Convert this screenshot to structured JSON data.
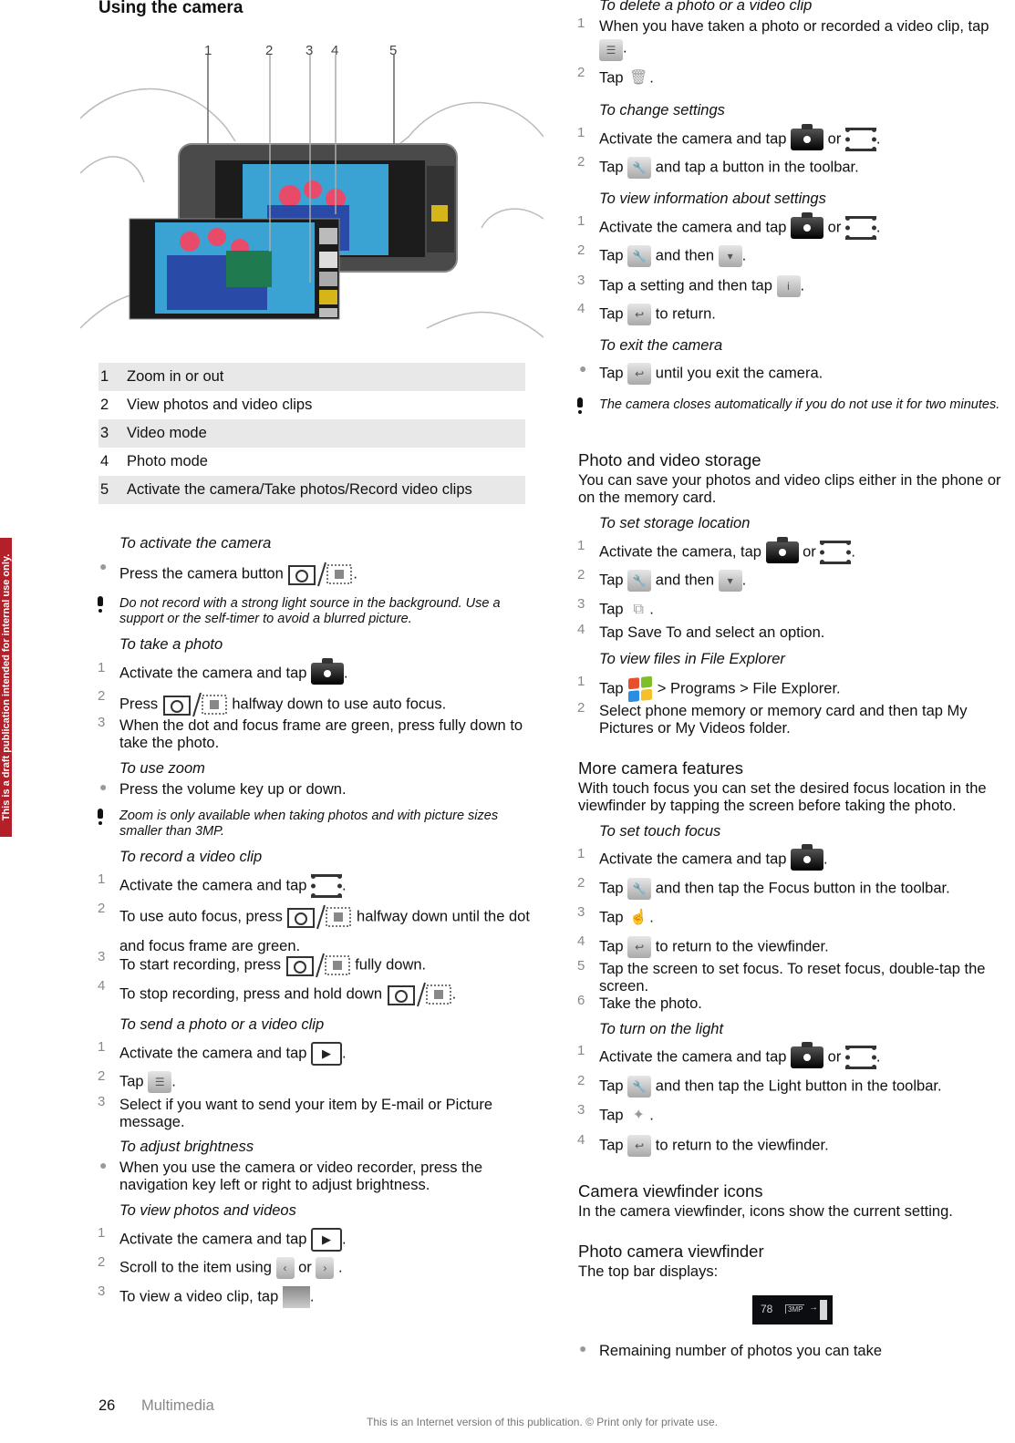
{
  "banner": {
    "text": "This is a draft publication intended for internal use only."
  },
  "left": {
    "title": "Using the camera",
    "figure": {
      "callouts": [
        "1",
        "2",
        "3",
        "4",
        "5"
      ],
      "description": "Two hands holding phone in landscape with camera viewfinder showing flowers"
    },
    "legend": [
      {
        "num": "1",
        "label": "Zoom in or out"
      },
      {
        "num": "2",
        "label": "View photos and video clips"
      },
      {
        "num": "3",
        "label": "Video mode"
      },
      {
        "num": "4",
        "label": "Photo mode"
      },
      {
        "num": "5",
        "label": "Activate the camera/Take photos/Record video clips"
      }
    ],
    "activate": {
      "title": "To activate the camera",
      "bullet": "Press the camera button",
      "note": "Do not record with a strong light source in the background. Use a support or the self-timer to avoid a blurred picture."
    },
    "take_photo": {
      "title": "To take a photo",
      "s1": "Activate the camera and tap",
      "s2a": "Press",
      "s2b": "halfway down to use auto focus.",
      "s3": "When the dot and focus frame are green, press fully down to take the photo."
    },
    "zoom": {
      "title": "To use zoom",
      "bullet": "Press the volume key up or down.",
      "note": "Zoom is only available when taking photos and with picture sizes smaller than 3MP."
    },
    "record": {
      "title": "To record a video clip",
      "s1": "Activate the camera and tap",
      "s2a": "To use auto focus, press",
      "s2b": "halfway down until the dot",
      "s2c": "and focus frame are green.",
      "s3a": "To start recording, press",
      "s3b": "fully down.",
      "s4": "To stop recording, press and hold down"
    },
    "send": {
      "title": "To send a photo or a video clip",
      "s1": "Activate the camera and tap",
      "s2": "Tap",
      "s3": "Select if you want to send your item by E-mail or Picture message."
    },
    "brightness": {
      "title": "To adjust brightness",
      "bullet": "When you use the camera or video recorder, press the navigation key left or right to adjust brightness."
    },
    "view": {
      "title": "To view photos and videos",
      "s1": "Activate the camera and tap",
      "s2a": "Scroll to the item using",
      "s2b": "or",
      "s3": "To view a video clip, tap"
    }
  },
  "right": {
    "delete": {
      "title": "To delete a photo or a video clip",
      "s1": "When you have taken a photo or recorded a video clip, tap",
      "s2": "Tap"
    },
    "change": {
      "title": "To change settings",
      "s1a": "Activate the camera and tap",
      "or": "or",
      "s2a": "Tap",
      "s2b": "and tap a button in the toolbar."
    },
    "info": {
      "title": "To view information about settings",
      "s1a": "Activate the camera and tap",
      "or": "or",
      "s2a": "Tap",
      "s2b": "and then",
      "s3": "Tap a setting and then tap",
      "s4a": "Tap",
      "s4b": "to return."
    },
    "exit": {
      "title": "To exit the camera",
      "bullet_a": "Tap",
      "bullet_b": "until you exit the camera.",
      "note": "The camera closes automatically if you do not use it for two minutes."
    },
    "storage": {
      "heading": "Photo and video storage",
      "body": "You can save your photos and video clips either in the phone or on the memory card.",
      "title": "To set storage location",
      "s1a": "Activate the camera, tap",
      "or": "or",
      "s2a": "Tap",
      "s2b": "and then",
      "s3": "Tap",
      "s4": "Tap Save To and select an option."
    },
    "explorer": {
      "title": "To view files in File Explorer",
      "s1a": "Tap",
      "s1b": "> Programs > File Explorer.",
      "s2": "Select phone memory or memory card and then tap My Pictures or My Videos folder."
    },
    "more": {
      "heading": "More camera features",
      "body": "With touch focus you can set the desired focus location in the viewfinder by tapping the screen before taking the photo.",
      "title": "To set touch focus",
      "s1": "Activate the camera and tap",
      "s2a": "Tap",
      "s2b": "and then tap the Focus button in the toolbar.",
      "s3": "Tap",
      "s4a": "Tap",
      "s4b": "to return to the viewfinder.",
      "s5": "Tap the screen to set focus. To reset focus, double-tap the screen.",
      "s6": "Take the photo."
    },
    "light": {
      "title": "To turn on the light",
      "s1a": "Activate the camera and tap",
      "or": "or",
      "s2a": "Tap",
      "s2b": "and then tap the Light button in the toolbar.",
      "s3": "Tap",
      "s4a": "Tap",
      "s4b": "to return to the viewfinder."
    },
    "icons": {
      "heading": "Camera viewfinder icons",
      "body": "In the camera viewfinder, icons show the current setting."
    },
    "photo_vf": {
      "heading": "Photo camera viewfinder",
      "body": "The top bar displays:",
      "bar_count": "78",
      "bar_size": "3MP",
      "bullet": "Remaining number of photos you can take"
    }
  },
  "footer": {
    "page": "26",
    "section": "Multimedia",
    "copyright": "This is an Internet version of this publication. © Print only for private use."
  }
}
